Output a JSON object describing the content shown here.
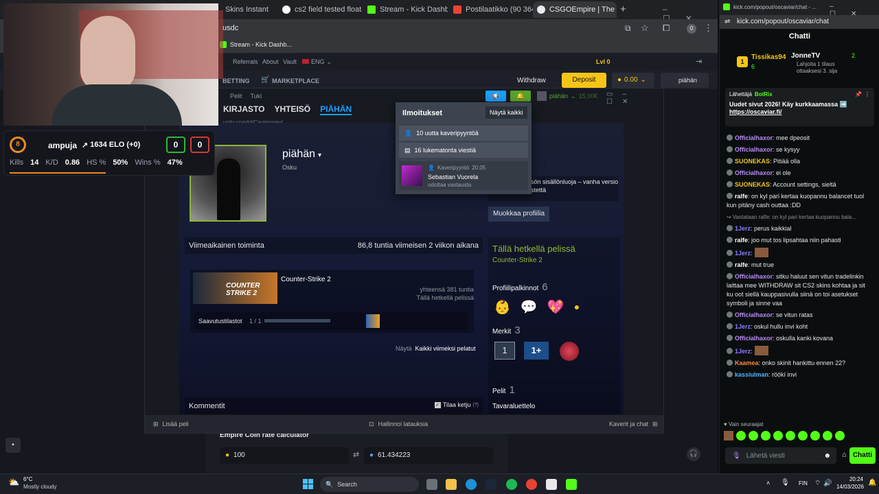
{
  "browser": {
    "tabs": [
      {
        "label": "Skins Instant"
      },
      {
        "label": "cs2 field tested floats"
      },
      {
        "label": "Stream - Kick Dashbo"
      },
      {
        "label": "Postilaatikko (90 364)"
      },
      {
        "label": "CSGOEmpire | The m"
      }
    ],
    "new_tab": "+",
    "address": "usdc",
    "profile_badge": "0",
    "bookmark": "Stream - Kick Dashb..."
  },
  "empire": {
    "nav_top": [
      "Referrals",
      "About",
      "Vault"
    ],
    "language": "ENG",
    "level": "Lvl 0",
    "betting": "BETTING",
    "marketplace": "MARKETPLACE",
    "withdraw": "Withdraw",
    "deposit": "Deposit",
    "balance": "0.00",
    "username": "piähän",
    "calc_title": "Empire Coin rate calculator",
    "calc_from": "100",
    "calc_to": "61.434223"
  },
  "steam": {
    "menu": [
      "Pelit",
      "Tuki"
    ],
    "nav": [
      "KIRJASTO",
      "YHTEISÖ",
      "PIÄHÄN"
    ],
    "url": "unity.com/id/Cavimoney/",
    "user_label": "piähän",
    "user_balance": "15,00€",
    "profile_name": "piähän",
    "profile_realname": "Osku",
    "notifications": {
      "title": "Ilmoitukset",
      "show_all": "Näytä kaikki",
      "friend_requests": "10 uutta kaveripyyntöä",
      "unread_comments": "16 lukematonta viestiä",
      "item_type": "Kaveripyyntö",
      "item_date": "20.05",
      "item_name": "Sebastian Vuorela",
      "item_status": "odottaa vastausta"
    },
    "side_text": "isön sisällönluoja – vanha versio",
    "side_text2": "istettä",
    "edit_profile": "Muokkaa profiilia",
    "recent_activity": "Viimeaikainen toiminta",
    "recent_hours": "86,8 tuntia viimeisen 2 viikon aikana",
    "game_name": "Counter-Strike 2",
    "game_banner": "COUNTER STRIKE 2",
    "game_total": "yhteensä 381 tuntia",
    "game_status": "Tällä hetkellä pelissä",
    "achievements_label": "Saavutustilastot",
    "achievements_value": "1 / 1",
    "show_label": "Näytä",
    "show_all_games": "Kaikki viimeksi pelatut",
    "comments": "Kommentit",
    "subscribe": "Tilaa ketju",
    "subscribe_hint": "(?)",
    "ingame_title": "Tällä hetkellä pelissä",
    "ingame_game": "Counter-Strike 2",
    "awards_label": "Profiilipalkinnot",
    "awards_count": "6",
    "badges_label": "Merkit",
    "badges_count": "3",
    "badge1": "1",
    "badge2": "1+",
    "games_label": "Pelit",
    "games_count": "1",
    "inventory_label": "Tavaraluettelo",
    "add_game": "Lisää peli",
    "manage_downloads": "Hallinnoi latauksia",
    "friends_chat": "Kaverit ja chat"
  },
  "stats": {
    "level": "8",
    "player": "ampuja",
    "elo": "1634 ELO (+0)",
    "wins": "0",
    "losses": "0",
    "kills_label": "Kills",
    "kills": "14",
    "kd_label": "K/D",
    "kd": "0.86",
    "hs_label": "HS %",
    "hs": "50%",
    "winrate_label": "Wins %",
    "winrate": "47%"
  },
  "chat": {
    "url": "kick.com/popout/oscaviar/chat",
    "title_bar": "kick.com/popout/oscaviar/chat - ...",
    "header": "Chatti",
    "top_gifter": "Tissikas94",
    "top_gifter_count": "6",
    "top2": "JonneTV",
    "top2_count": "2",
    "top2_note": "Lahjoita 1 tilaus",
    "top2_note2": "ottaaksesi 3. sija",
    "pinned_sender_label": "Lähettäjä",
    "pinned_sender": "BotRix",
    "pinned_text": "Uudet sivut 2026! Käy kurkkaamassa ➡️",
    "pinned_link": "https://oscaviar.fi/",
    "messages": [
      {
        "user": "Officialhaxor",
        "text": ": mee dpeosit",
        "color": "#b98af7"
      },
      {
        "user": "Officialhaxor",
        "text": ": se kysyy",
        "color": "#b98af7"
      },
      {
        "user": "SUONEKAS",
        "text": ": Pitiää olla",
        "color": "#f0c430"
      },
      {
        "user": "Officialhaxor",
        "text": ": ei ole",
        "color": "#b98af7"
      },
      {
        "user": "SUONEKAS",
        "text": ": Account settings, sieltä",
        "color": "#f0c430"
      },
      {
        "user": "ralfe",
        "text": ": on kyl pari kertaa kuopannu balancet tuol kun pitäny cash outtaa :DD",
        "color": "#ffffff"
      },
      {
        "user": "",
        "text": "↪ Vastataan ralfe: on kyl pari kertaa kuopannu bala...",
        "color": "#8a8f93"
      },
      {
        "user": "1Jerz",
        "text": ": perus kaikkial",
        "color": "#8a7cff"
      },
      {
        "user": "ralfe",
        "text": ": joo mut tos lipsahtaa niin pahasti",
        "color": "#ffffff"
      },
      {
        "user": "1Jerz",
        "text": ":",
        "color": "#8a7cff"
      },
      {
        "user": "ralfe",
        "text": ": mut true",
        "color": "#ffffff"
      },
      {
        "user": "Officialhaxor",
        "text": ": sitku haluut sen vitun tradelinkin laittaa mee WITHDRAW sit CS2 skins kohtaa ja sit ku oot siellä kauppasivulla siinä on toi asetukset symboli ja sinne vaa",
        "color": "#b98af7"
      },
      {
        "user": "Officialhaxor",
        "text": ": se vitun ratas",
        "color": "#b98af7"
      },
      {
        "user": "1Jerz",
        "text": ": oskul hullu invi koht",
        "color": "#8a7cff"
      },
      {
        "user": "Officialhaxor",
        "text": ": oskulla kanki kovana",
        "color": "#b98af7"
      },
      {
        "user": "1Jerz",
        "text": ":",
        "color": "#8a7cff"
      },
      {
        "user": "Kaamea",
        "text": ": onko skinit hankittu ennen 22?",
        "color": "#ff8a3d"
      },
      {
        "user": "kassiulman",
        "text": ": röökí invi",
        "color": "#4fb6ff"
      }
    ],
    "followers_only": "Vain seuraajat",
    "send_placeholder": "Lähetä viesti",
    "send_button": "Chatti"
  },
  "taskbar": {
    "weather_temp": "6°C",
    "weather_desc": "Mostly cloudy",
    "search": "Search",
    "language": "FIN",
    "time": "20:24",
    "date": "14/03/2026"
  },
  "colors": {
    "steam_blue": "#66c0f4",
    "kick_green": "#53fc18",
    "deposit_yellow": "#f5c518"
  }
}
